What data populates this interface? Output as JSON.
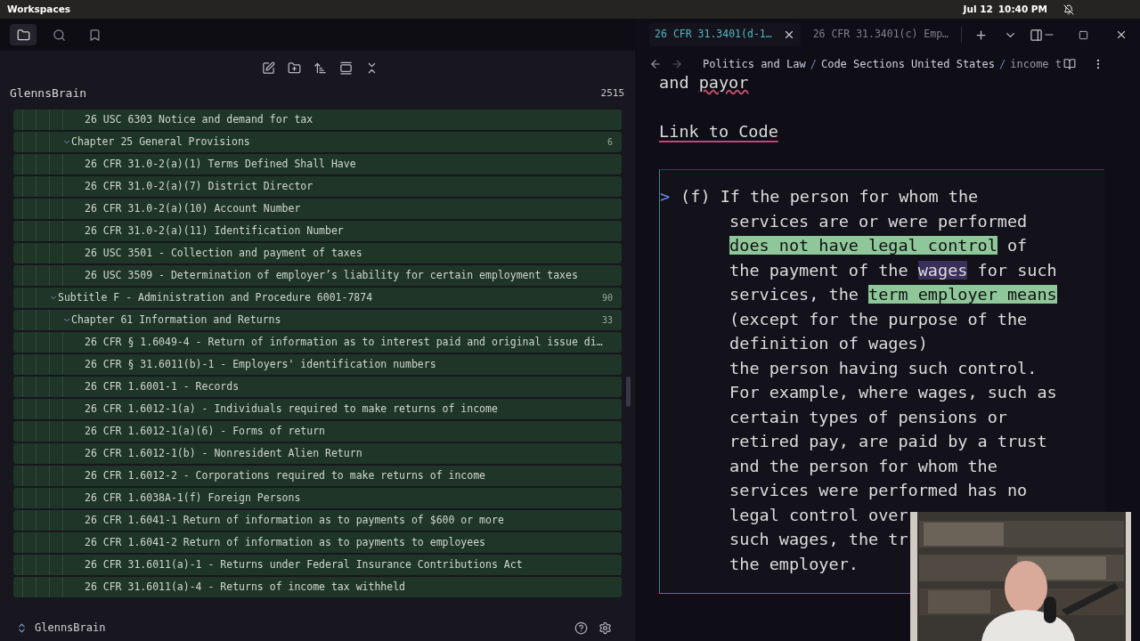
{
  "system_bar": {
    "title": "Workspaces",
    "date": "Jul 12",
    "time": "10:40 PM"
  },
  "sidebar": {
    "tabs": [
      {
        "selected": true
      },
      {
        "selected": false
      },
      {
        "selected": false
      }
    ],
    "vault": {
      "name": "GlennsBrain",
      "count": "2515"
    },
    "tree": [
      {
        "children": [
          {
            "children": [
              {
                "label": "26 USC 6303 Notice and demand for tax"
              }
            ]
          },
          {
            "label": "Chapter 25 General Provisions",
            "count": "6",
            "expanded": true,
            "children": [
              {
                "label": "26 CFR 31.0-2(a)(1) Terms Defined Shall Have"
              },
              {
                "label": "26 CFR 31.0-2(a)(7) District Director"
              },
              {
                "label": "26 CFR 31.0-2(a)(10) Account Number"
              },
              {
                "label": "26 CFR 31.0-2(a)(11) Identification Number"
              },
              {
                "label": "26 USC 3501 - Collection and payment of taxes"
              },
              {
                "label": "26 USC 3509 - Determination of employer’s liability for certain employment taxes"
              }
            ]
          }
        ]
      },
      {
        "label": "Subtitle F - Administration and Procedure 6001-7874",
        "count": "90",
        "expanded": true,
        "children": [
          {
            "label": "Chapter 61 Information and Returns",
            "count": "33",
            "expanded": true,
            "children": [
              {
                "label": "26 CFR § 1.6049-4 - Return of information as to interest paid and original issue di…"
              },
              {
                "label": "26 CFR § 31.6011(b)-1 - Employers' identification numbers"
              },
              {
                "label": "26 CFR 1.6001-1 - Records"
              },
              {
                "label": "26 CFR 1.6012-1(a) - Individuals required to make returns of income"
              },
              {
                "label": "26 CFR 1.6012-1(a)(6) - Forms of return"
              },
              {
                "label": "26 CFR 1.6012-1(b) - Nonresident Alien Return"
              },
              {
                "label": "26 CFR 1.6012-2 - Corporations required to make returns of income"
              },
              {
                "label": "26 CFR 1.6038A-1(f) Foreign Persons"
              },
              {
                "label": "26 CFR 1.6041-1 Return of information as to payments of $600 or more"
              },
              {
                "label": "26 CFR 1.6041-2 Return of information as to payments to employees"
              },
              {
                "label": "26 CFR 31.6011(a)-1 - Returns under Federal Insurance Contributions Act"
              },
              {
                "label": "26 CFR 31.6011(a)-4 - Returns of income tax withheld"
              }
            ]
          }
        ]
      }
    ],
    "footer_vault": "GlennsBrain"
  },
  "tabs": [
    {
      "title": "26 CFR 31.3401(d-1…",
      "selected": true
    },
    {
      "title": "26 CFR 31.3401(c) Emp…",
      "selected": false
    }
  ],
  "breadcrumb": {
    "separator": "/",
    "items": [
      "Politics and Law",
      "Code Sections United States",
      "income t"
    ]
  },
  "note": {
    "top_line": [
      {
        "text": "and "
      },
      {
        "text": "payor",
        "spelling_error": true
      }
    ],
    "link": "Link to Code",
    "callout": {
      "marker": ">",
      "lines": [
        [
          {
            "text": "(f) If the person for whom the"
          }
        ],
        [
          {
            "text": "services are or were performed"
          }
        ],
        [
          {
            "text": "does not have legal control",
            "highlighted": true
          },
          {
            "text": " of"
          }
        ],
        [
          {
            "text": "the payment of the "
          },
          {
            "text": "wages",
            "selected": true
          },
          {
            "text": " for such"
          }
        ],
        [
          {
            "text": "services, the "
          },
          {
            "text": "term employer means",
            "highlighted": true
          }
        ],
        [
          {
            "text": "(except for the purpose of the"
          }
        ],
        [
          {
            "text": "definition of wages)"
          }
        ],
        [
          {
            "text": "the person having such control."
          }
        ],
        [
          {
            "text": "For example, where wages, such as"
          }
        ],
        [
          {
            "text": "certain types of pensions or"
          }
        ],
        [
          {
            "text": "retired pay, are paid by a trust"
          }
        ],
        [
          {
            "text": "and the person for whom the"
          }
        ],
        [
          {
            "text": "services were performed has no"
          }
        ],
        [
          {
            "text": "legal control over"
          }
        ],
        [
          {
            "text": "such wages, the tr"
          }
        ],
        [
          {
            "text": "the employer."
          }
        ]
      ]
    }
  }
}
